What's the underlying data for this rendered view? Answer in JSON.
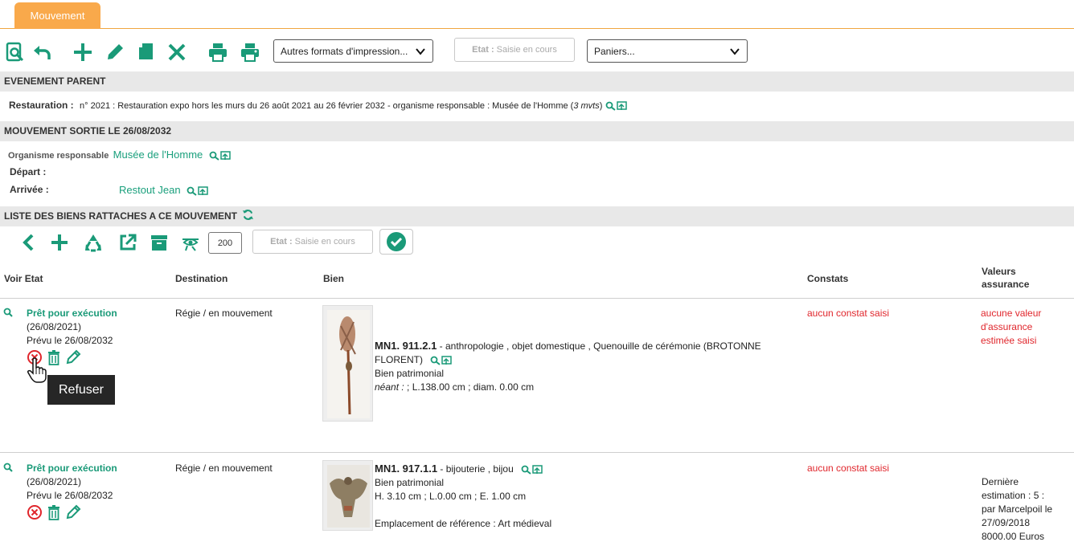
{
  "tab": {
    "label": "Mouvement"
  },
  "toolbar": {
    "print_formats": "Autres formats d'impression...",
    "etat_label": "Etat :",
    "etat_value": "Saisie en cours",
    "paniers": "Paniers..."
  },
  "parent_event": {
    "section_title": "EVENEMENT PARENT",
    "label": "Restauration :",
    "text": "n° 2021 : Restauration expo hors les murs du 26 août 2021 au 26 février 2032 - organisme responsable : Musée de l'Homme (",
    "mvts": "3 mvts",
    "close": ")"
  },
  "movement": {
    "section_title": "MOUVEMENT SORTIE LE 26/08/2032",
    "org_label": "Organisme responsable",
    "org_value": "Musée de l'Homme",
    "depart_label": "Départ :",
    "arrivee_label": "Arrivée :",
    "arrivee_value": "Restout Jean"
  },
  "list": {
    "section_title": "LISTE DES BIENS RATTACHES A CE MOUVEMENT",
    "count": "200",
    "etat_label": "Etat :",
    "etat_value": "Saisie en cours"
  },
  "table": {
    "headers": {
      "voir_etat": "Voir Etat",
      "destination": "Destination",
      "bien": "Bien",
      "constats": "Constats",
      "valeurs_1": "Valeurs",
      "valeurs_2": "assurance"
    },
    "rows": [
      {
        "status": "Prêt pour exécution",
        "date": "(26/08/2021)",
        "prevu": "Prévu le 26/08/2032",
        "destination": "Régie / en mouvement",
        "bien_id": "MN1. 911.2.1",
        "bien_desc": " - anthropologie , objet domestique , Quenouille de cérémonie (BROTONNE",
        "bien_desc2": "FLORENT)",
        "bien_type": "Bien patrimonial",
        "bien_dim_label": "néant :",
        "bien_dim": " ; L.138.00 cm ; diam. 0.00 cm",
        "constats": "aucun constat saisi",
        "valeur_1": "aucune valeur",
        "valeur_2": "d'assurance",
        "valeur_3": "estimée saisi"
      },
      {
        "status": "Prêt pour exécution",
        "date": "(26/08/2021)",
        "prevu": "Prévu le 26/08/2032",
        "destination": "Régie / en mouvement",
        "bien_id": "MN1. 917.1.1",
        "bien_desc": " - bijouterie , bijou",
        "bien_type": "Bien patrimonial",
        "bien_dim": "H. 3.10 cm ; L.0.00 cm ; E. 1.00 cm",
        "bien_loc": "Emplacement de référence : Art médieval",
        "constats": "aucun constat saisi",
        "valeur_1": "Dernière",
        "valeur_2": "estimation :  5 :",
        "valeur_3": "par Marcelpoil le",
        "valeur_4": "27/09/2018",
        "valeur_5": "8000.00 Euros"
      }
    ]
  },
  "tooltip": {
    "text": "Refuser"
  },
  "colors": {
    "accent": "#1a9a78",
    "tab": "#f9a94b",
    "error": "#e0262c"
  }
}
